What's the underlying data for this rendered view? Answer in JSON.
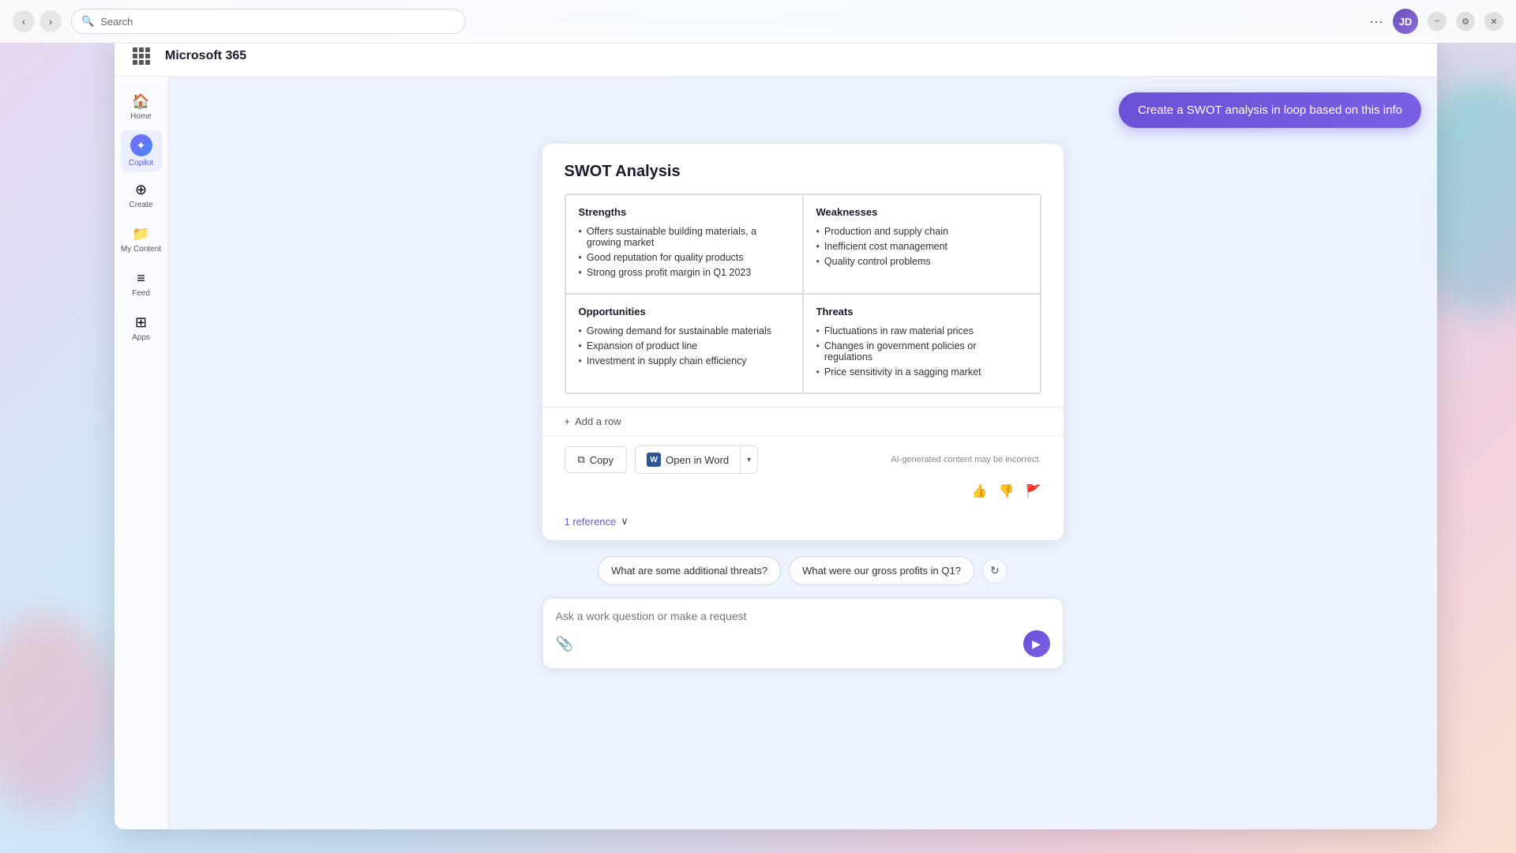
{
  "browser": {
    "search_placeholder": "Search",
    "search_value": "",
    "dots": "···",
    "avatar_initials": "JD",
    "win_minimize": "−",
    "win_settings": "⚙",
    "win_close": "✕"
  },
  "app": {
    "title": "Microsoft 365"
  },
  "sidebar": {
    "items": [
      {
        "id": "home",
        "label": "Home",
        "icon": "🏠"
      },
      {
        "id": "copilot",
        "label": "Copilot",
        "icon": "✦"
      },
      {
        "id": "create",
        "label": "Create",
        "icon": "⊕"
      },
      {
        "id": "my-content",
        "label": "My Content",
        "icon": "📁"
      },
      {
        "id": "feed",
        "label": "Feed",
        "icon": "📊"
      },
      {
        "id": "apps",
        "label": "Apps",
        "icon": "⊞"
      }
    ]
  },
  "copilot": {
    "create_swot_btn": "Create a SWOT analysis in loop based on this info",
    "swot": {
      "title": "SWOT Analysis",
      "strengths": {
        "header": "Strengths",
        "items": [
          "Offers sustainable building materials, a growing market",
          "Good reputation for quality products",
          "Strong gross profit margin in Q1 2023"
        ]
      },
      "weaknesses": {
        "header": "Weaknesses",
        "items": [
          "Production and supply chain",
          "Inefficient cost management",
          "Quality control problems"
        ]
      },
      "opportunities": {
        "header": "Opportunities",
        "items": [
          "Growing demand for sustainable materials",
          "Expansion of product line",
          "Investment in supply chain efficiency"
        ]
      },
      "threats": {
        "header": "Threats",
        "items": [
          "Fluctuations in raw material prices",
          "Changes in government policies or regulations",
          "Price sensitivity in a sagging market"
        ]
      },
      "add_row": "+ Add a row",
      "copy_btn": "Copy",
      "open_word_btn": "Open in Word",
      "ai_disclaimer": "AI-generated content may be incorrect.",
      "reference_label": "1 reference",
      "reference_icon": "∨"
    },
    "suggestions": [
      "What are some additional threats?",
      "What were our gross profits in Q1?"
    ],
    "input_placeholder": "Ask a work question or make a request"
  }
}
